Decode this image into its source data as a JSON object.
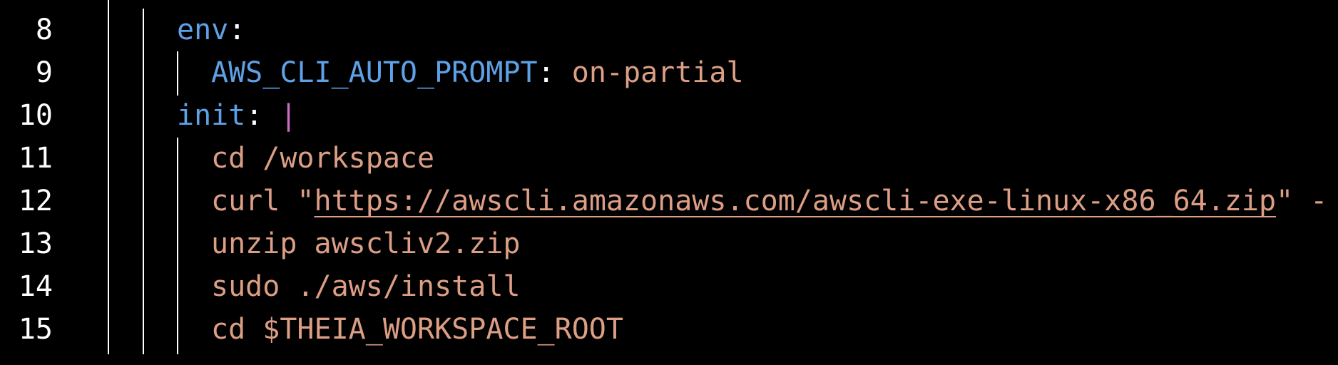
{
  "editor": {
    "lines": [
      {
        "number": "8",
        "key": "env",
        "colon": ":"
      },
      {
        "number": "9",
        "key": "AWS_CLI_AUTO_PROMPT",
        "colon": ":",
        "value": "on-partial"
      },
      {
        "number": "10",
        "key": "init",
        "colon": ":",
        "pipe": "|"
      },
      {
        "number": "11",
        "text": "cd /workspace"
      },
      {
        "number": "12",
        "prefix": "curl \"",
        "url": "https://awscli.amazonaws.com/awscli-exe-linux-x86_64.zip",
        "suffix": "\" -"
      },
      {
        "number": "13",
        "text": "unzip awscliv2.zip"
      },
      {
        "number": "14",
        "text": "sudo ./aws/install"
      },
      {
        "number": "15",
        "text": "cd $THEIA_WORKSPACE_ROOT"
      }
    ]
  },
  "colors": {
    "background": "#000000",
    "key": "#5ea1e6",
    "string": "#dc9e85",
    "block_scalar_pipe": "#c76fc2",
    "line_numbers": "#ffffff"
  }
}
